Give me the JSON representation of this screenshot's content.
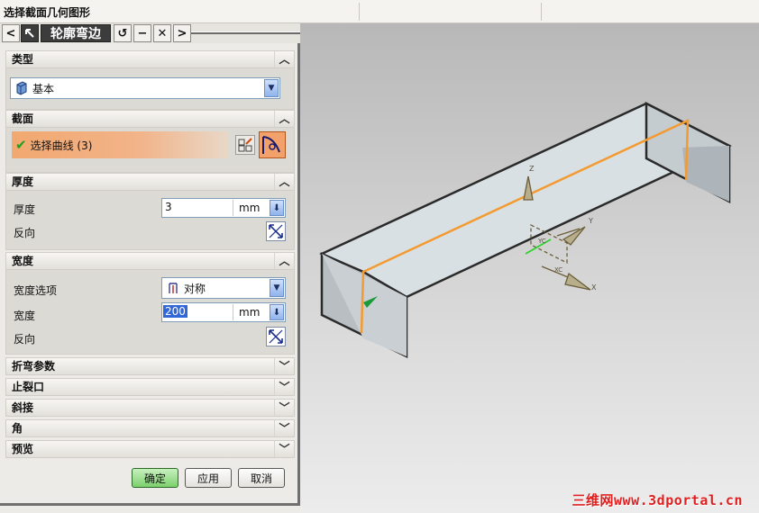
{
  "status_bar": {
    "prompt": "选择截面几何图形"
  },
  "tab_strip": {
    "back": "<",
    "forward": ">",
    "title": "轮廓弯边",
    "reset": "↺",
    "minimize": "−",
    "close": "✕"
  },
  "groups": {
    "type": {
      "label": "类型",
      "combo_value": "基本"
    },
    "section": {
      "label": "截面",
      "select_label": "选择曲线 (3)"
    },
    "thickness": {
      "label": "厚度",
      "thickness_label": "厚度",
      "thickness_value": "3",
      "thickness_unit": "mm",
      "reverse_label": "反向"
    },
    "width": {
      "label": "宽度",
      "option_label": "宽度选项",
      "option_value": "对称",
      "width_label": "宽度",
      "width_value": "200",
      "width_unit": "mm",
      "reverse_label": "反向"
    },
    "collapsed": [
      "折弯参数",
      "止裂口",
      "斜接",
      "角",
      "预览"
    ]
  },
  "buttons": {
    "ok": "确定",
    "apply": "应用",
    "cancel": "取消"
  },
  "viewport": {
    "triad_labels": {
      "z": "Z",
      "y": "Y",
      "x": "X",
      "xc": "XC",
      "yc": "YC"
    },
    "watermark": "三维网www.3dportal.cn",
    "colors": {
      "edge": "#f39a30",
      "check": "#1ea01e",
      "face": "#d8dfe4",
      "body_edge": "#2a2a2a"
    }
  }
}
